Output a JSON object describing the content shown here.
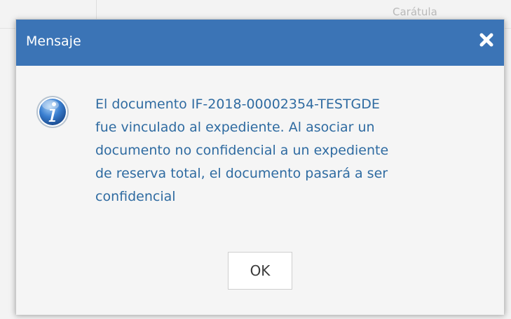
{
  "background": {
    "header_text": "Carátula"
  },
  "dialog": {
    "title": "Mensaje",
    "close_icon": "close-icon",
    "info_icon": "info-icon",
    "message": "El documento IF-2018-00002354-TESTGDE\nfue vinculado al expediente. Al asociar un\ndocumento no confidencial a un expediente\nde reserva total, el documento pasará a ser\nconfidencial",
    "ok_label": "OK",
    "colors": {
      "header": "#3b74b6",
      "message_text": "#2f6ba1",
      "body_bg": "#f5f5f5"
    }
  }
}
